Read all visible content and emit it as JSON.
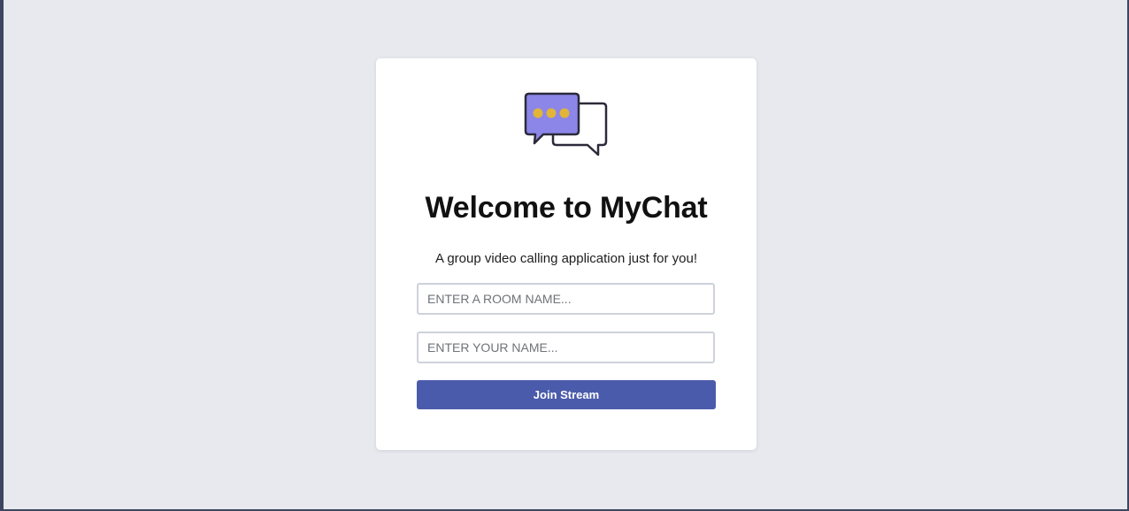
{
  "app": {
    "logo_icon": "chat-bubbles-icon",
    "title": "Welcome to MyChat",
    "subtitle": "A group video calling application just for you!"
  },
  "form": {
    "room_input": {
      "value": "",
      "placeholder": "ENTER A ROOM NAME..."
    },
    "name_input": {
      "value": "",
      "placeholder": "ENTER YOUR NAME..."
    },
    "submit_label": "Join Stream"
  },
  "colors": {
    "page_background": "#e7e9ee",
    "card_background": "#ffffff",
    "accent": "#4b5bab",
    "logo_bubble_fill": "#8b86e8",
    "logo_dots": "#e0b53a",
    "logo_outline": "#2c2a3a"
  }
}
